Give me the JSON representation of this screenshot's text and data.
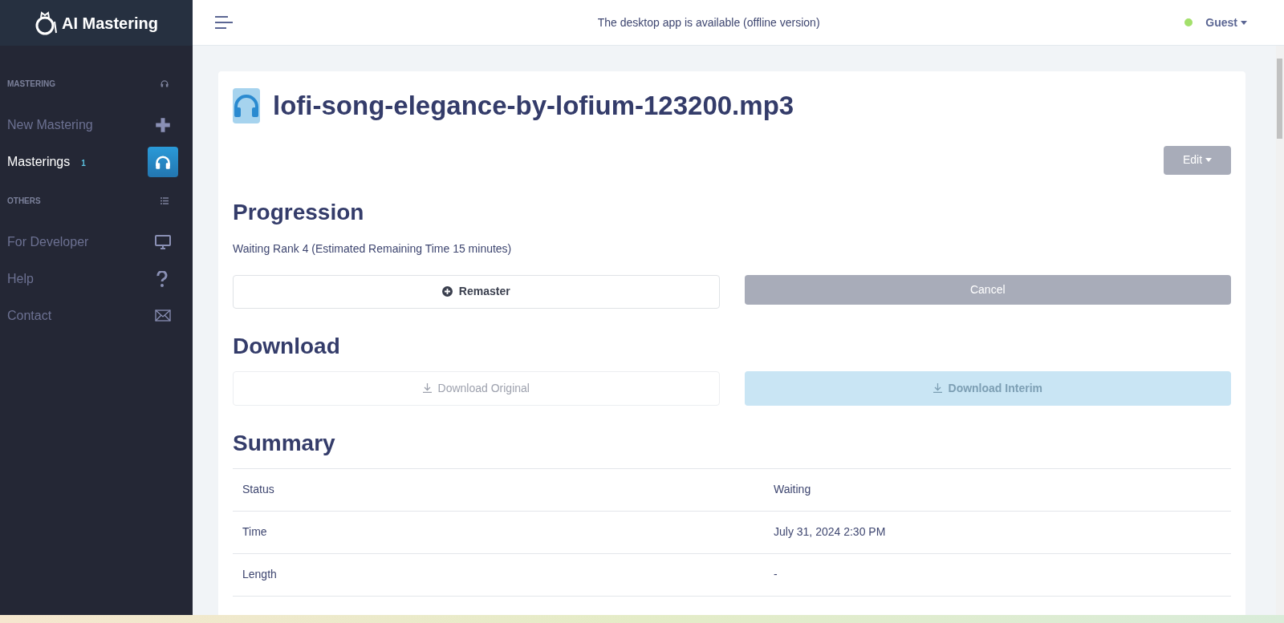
{
  "sidebar": {
    "brand": "AI Mastering",
    "sections": [
      {
        "title": "MASTERING",
        "items": [
          {
            "label": "New Mastering",
            "selected": false
          },
          {
            "label": "Masterings",
            "badge": "1",
            "selected": true
          }
        ]
      },
      {
        "title": "OTHERS",
        "items": [
          {
            "label": "For Developer",
            "selected": false
          },
          {
            "label": "Help",
            "selected": false
          },
          {
            "label": "Contact",
            "selected": false
          }
        ]
      }
    ]
  },
  "header": {
    "notice": "The desktop app is available (offline version)",
    "user": "Guest",
    "online": true
  },
  "page": {
    "title": "lofi-song-elegance-by-lofium-123200.mp3",
    "edit_button": "Edit",
    "progression": {
      "heading": "Progression",
      "status": "Waiting Rank 4 (Estimated Remaining Time 15 minutes)",
      "buttons": [
        {
          "label": "Remaster",
          "kind": "outline",
          "disabled": false
        },
        {
          "label": "Cancel",
          "kind": "grey",
          "disabled": false
        }
      ]
    },
    "download": {
      "heading": "Download",
      "buttons": [
        {
          "label": "Download Original",
          "kind": "outline",
          "disabled": true
        },
        {
          "label": "Download Interim",
          "kind": "blue",
          "disabled": true
        }
      ]
    },
    "summary": {
      "heading": "Summary",
      "rows": [
        {
          "label": "Status",
          "value": "Waiting"
        },
        {
          "label": "Time",
          "value": "July 31, 2024 2:30 PM"
        },
        {
          "label": "Length",
          "value": "-"
        }
      ]
    }
  }
}
